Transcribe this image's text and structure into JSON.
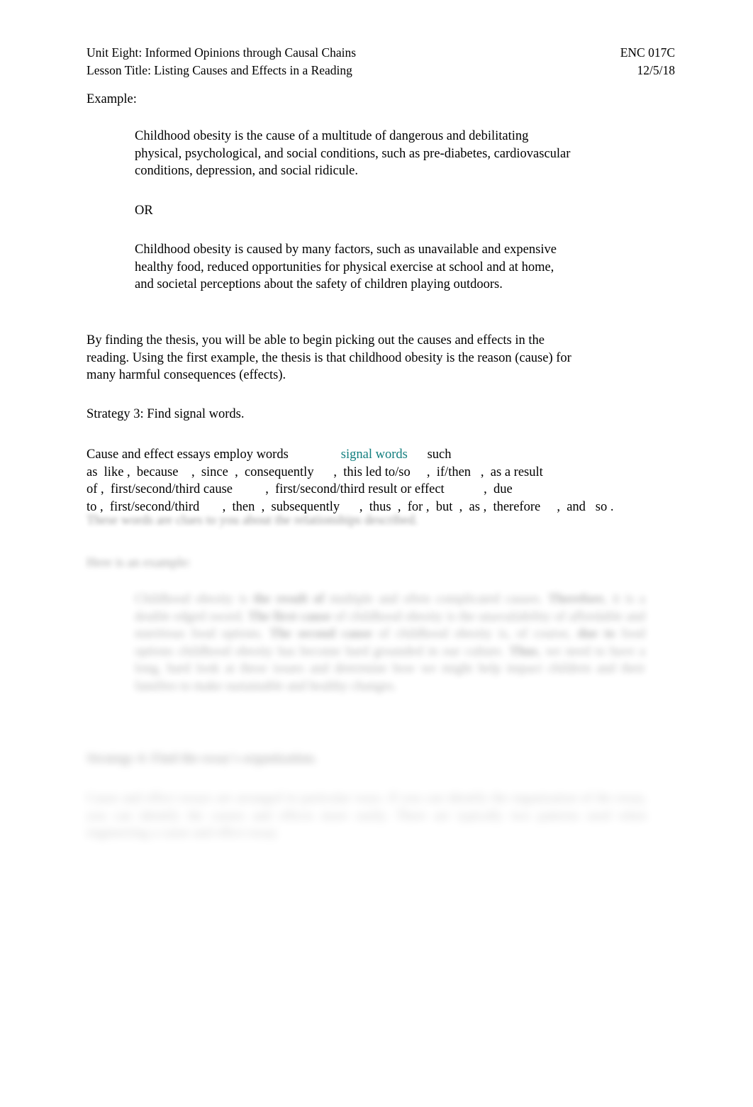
{
  "header": {
    "line1_left": "Unit Eight: Informed Opinions through Causal Chains",
    "line1_right": "ENC 017C",
    "line2_left": "Lesson Title: Listing Causes and Effects in a Reading",
    "line2_right": "12/5/18"
  },
  "body": {
    "example_label": "Example:",
    "example_one": "Childhood obesity is the cause of a multitude of dangerous and debilitating physical, psychological, and social conditions, such as pre-diabetes, cardiovascular conditions, depression, and social ridicule.",
    "or_label": "OR",
    "example_two": "Childhood obesity is caused by many factors, such as unavailable and expensive healthy food, reduced opportunities for physical exercise at school and at home, and societal perceptions about the safety of children playing outdoors.",
    "thesis_paragraph": "By finding the thesis, you will be able to begin picking out the causes and effects in the reading. Using the first example, the thesis is that childhood obesity is the reason (cause) for many harmful consequences (effects).",
    "strategy_3": "Strategy 3: Find signal words.",
    "signal_intro": "Cause and effect essays employ words",
    "signal_highlight": "signal words",
    "signal_rest_a": "such",
    "signal_line2": "as  like ,  because    ,  since  ,  consequently      ,  this led to/so     ,  if/then   ,  as a result",
    "signal_line3": "of ,  first/second/third cause          ,  first/second/third result or effect            ,  due",
    "signal_line4": "to ,  first/second/third       ,  then  ,  subsequently      ,  thus  ,  for ,  but  ,  as ,  therefore     ,  and   so ."
  },
  "faded": {
    "line_1": "These words are clues to you about the relationships described.",
    "line_2": "Here is an example:",
    "block_text_a": "Childhood obesity is ",
    "block_bold_a": "the result of",
    "block_text_b": " multiple and often complicated causes. ",
    "block_bold_b": "Therefore",
    "block_text_c": ", it is a double edged sword. ",
    "block_bold_c": "The first cause",
    "block_text_d": " of childhood obesity is the unavailability of affordable and nutritious food options. ",
    "block_bold_d": "The second cause",
    "block_text_e": " of childhood obesity is, of course, ",
    "block_bold_e": "due to",
    "block_text_f": " food options childhood obesity has become hard grounded in our culture. ",
    "block_bold_f": "Thus",
    "block_text_g": ", we need to have a long, hard look at these issues and determine how we might help impact children and their families to make sustainable and healthy changes.",
    "heading_4": "Strategy 4: Find the essay's organization.",
    "final_paragraph": "Cause and effect essays are arranged in particular ways. If you can identify the organization of the essay, you can identify the causes and effects more easily. There are typically two patterns used when engineering a cause and effect essay."
  },
  "colors": {
    "page_background": "#ffffff",
    "text": "#000000",
    "highlight_teal": "#117e7e"
  }
}
